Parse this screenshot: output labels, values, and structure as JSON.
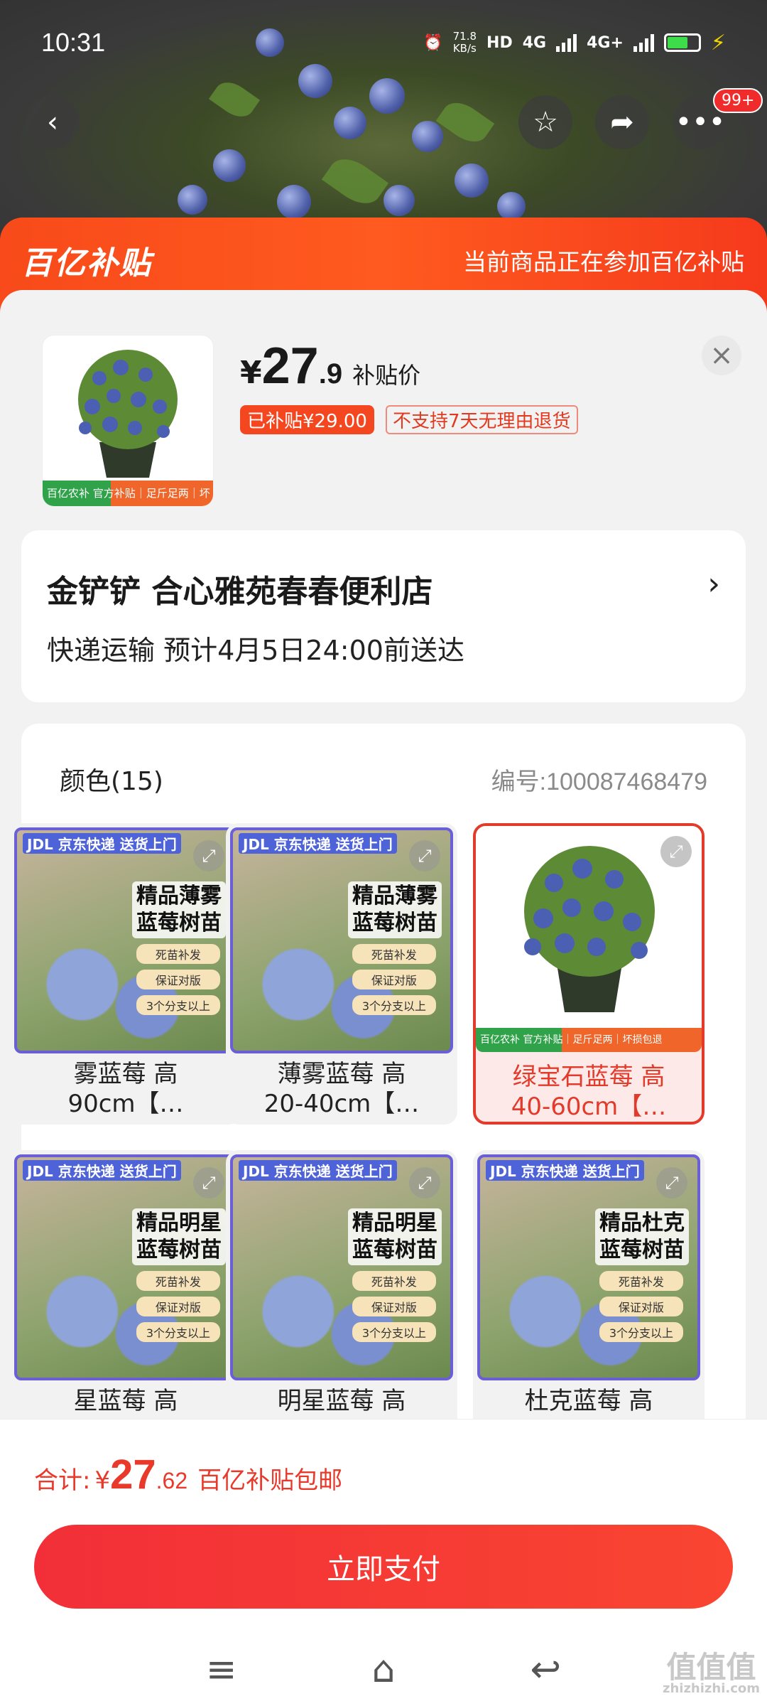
{
  "status": {
    "time": "10:31",
    "net_speed_value": "71.8",
    "net_speed_unit": "KB/s",
    "hd": "HD",
    "net1": "4G",
    "net2": "4G+"
  },
  "header": {
    "back_icon": "chevron-left-icon",
    "favorite_icon": "star-icon",
    "share_icon": "share-icon",
    "more_icon": "more-icon",
    "more_badge": "99+"
  },
  "banner": {
    "logo": "百亿补贴",
    "text": "当前商品正在参加百亿补贴"
  },
  "product": {
    "thumb_strip": "百亿农补 官方补贴｜足斤足两｜坏损包退",
    "price_yen": "¥",
    "price_int": "27",
    "price_dec": ".9",
    "price_label": "补贴价",
    "tag_subsidy": "已补贴¥29.00",
    "tag_return": "不支持7天无理由退货"
  },
  "store": {
    "name": "金铲铲  合心雅苑春春便利店",
    "delivery": "快递运输  预计4月5日24:00前送达"
  },
  "variants": {
    "title": "颜色(15)",
    "sku": "编号:100087468479",
    "items": [
      {
        "badge": "JDL 京东快递 送货上门",
        "headline": "精品薄雾\n蓝莓树苗",
        "chips": [
          "死苗补发",
          "保证对版",
          "3个分支以上"
        ],
        "caption": "雾蓝莓 高\n90cm【…"
      },
      {
        "badge": "JDL 京东快递 送货上门",
        "headline": "精品薄雾\n蓝莓树苗",
        "chips": [
          "死苗补发",
          "保证对版",
          "3个分支以上"
        ],
        "caption": "薄雾蓝莓 高\n20-40cm【…"
      },
      {
        "badge": "",
        "headline": "",
        "chips": [],
        "caption": "绿宝石蓝莓 高\n40-60cm【…",
        "strip": "百亿农补 官方补贴｜足斤足两｜坏损包退"
      },
      {
        "badge": "JDL 京东快递 送货上门",
        "headline": "精品明星\n蓝莓树苗",
        "chips": [
          "死苗补发",
          "保证对版",
          "3个分支以上"
        ],
        "caption": "星蓝莓 高"
      },
      {
        "badge": "JDL 京东快递 送货上门",
        "headline": "精品明星\n蓝莓树苗",
        "chips": [
          "死苗补发",
          "保证对版",
          "3个分支以上"
        ],
        "caption": "明星蓝莓 高"
      },
      {
        "badge": "JDL 京东快递 送货上门",
        "headline": "精品杜克\n蓝莓树苗",
        "chips": [
          "死苗补发",
          "保证对版",
          "3个分支以上"
        ],
        "caption": "杜克蓝莓 高"
      }
    ]
  },
  "footer": {
    "total_label": "合计:",
    "total_yen": "¥",
    "total_int": "27",
    "total_dec": ".62",
    "total_note": "百亿补贴包邮",
    "pay_label": "立即支付"
  },
  "watermark": {
    "main": "值值值",
    "sub": "zhizhizhi.com"
  },
  "colors": {
    "accent": "#e8392a",
    "banner": "#f84a1a"
  }
}
